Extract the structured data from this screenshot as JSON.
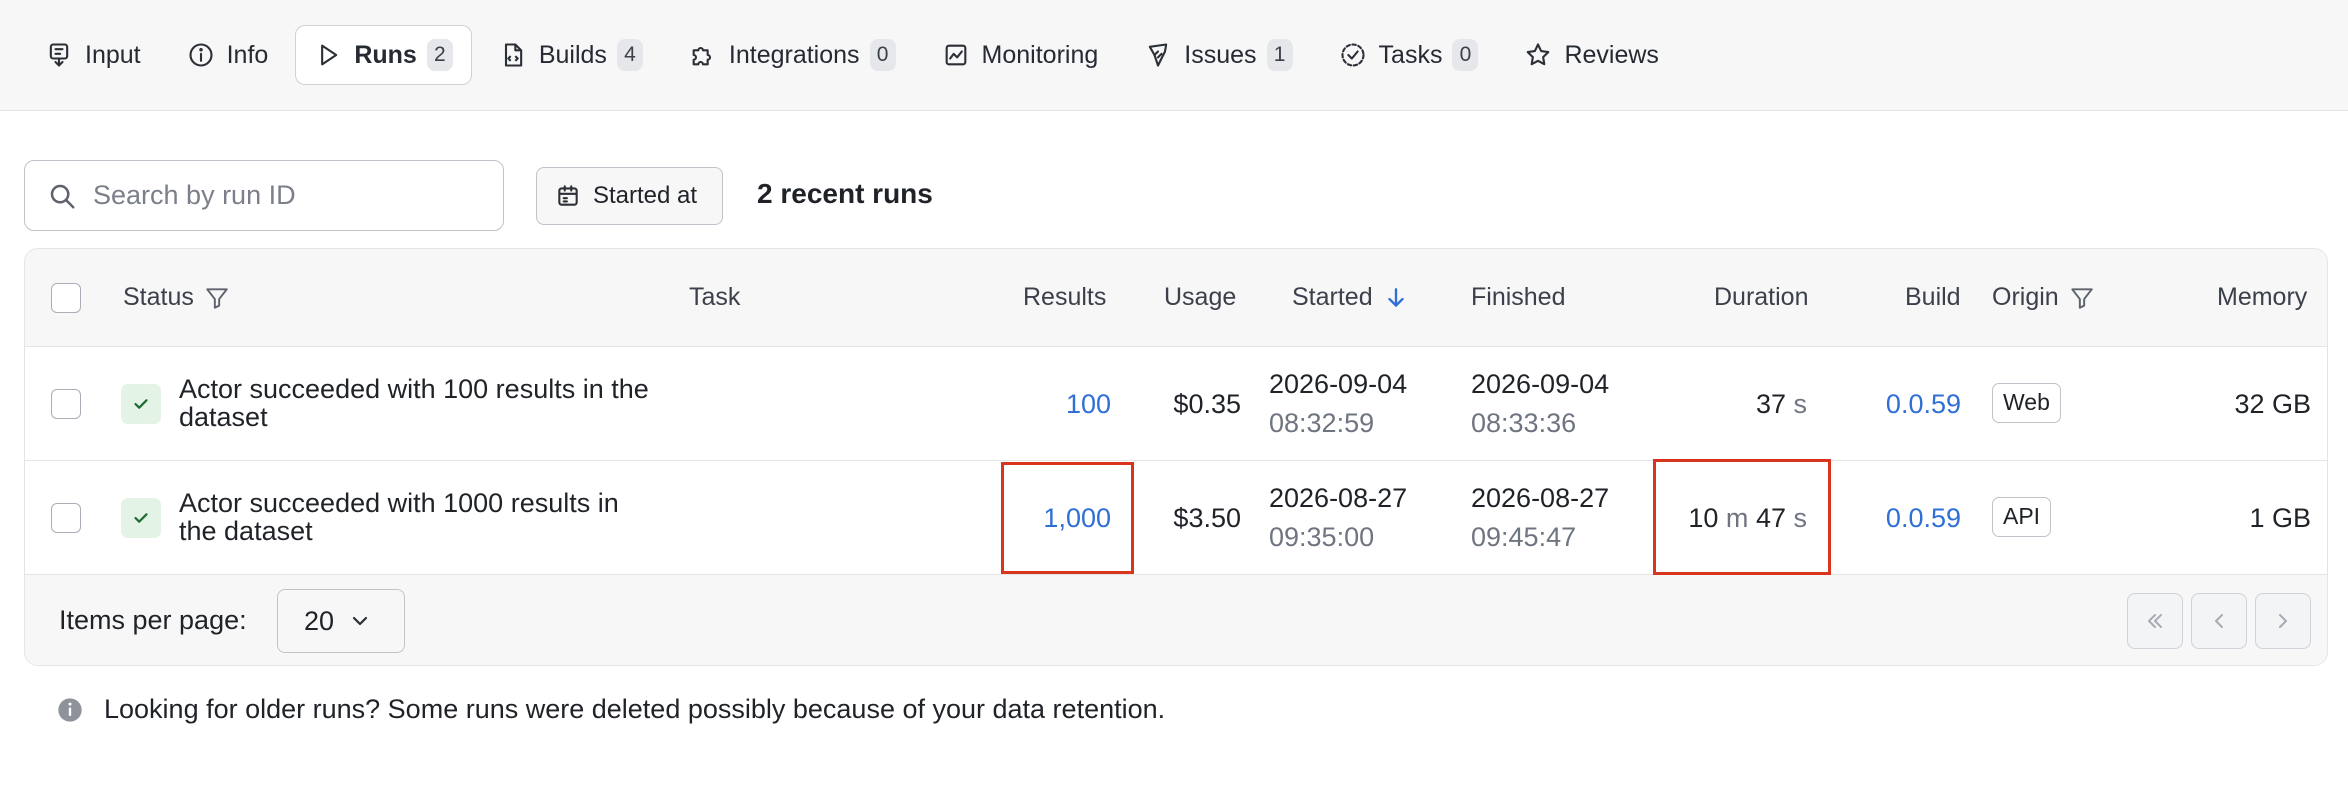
{
  "tabs": [
    {
      "label": "Input",
      "icon": "input-icon",
      "count": ""
    },
    {
      "label": "Info",
      "icon": "info-icon",
      "count": ""
    },
    {
      "label": "Runs",
      "icon": "play-icon",
      "count": "2",
      "active": true
    },
    {
      "label": "Builds",
      "icon": "file-icon",
      "count": "4"
    },
    {
      "label": "Integrations",
      "icon": "puzzle-icon",
      "count": "0"
    },
    {
      "label": "Monitoring",
      "icon": "chart-icon",
      "count": ""
    },
    {
      "label": "Issues",
      "icon": "bug-icon",
      "count": "1"
    },
    {
      "label": "Tasks",
      "icon": "task-icon",
      "count": "0"
    },
    {
      "label": "Reviews",
      "icon": "star-icon",
      "count": ""
    }
  ],
  "toolbar": {
    "search_placeholder": "Search by run ID",
    "date_filter_label": "Started at",
    "recent_runs_label": "2 recent runs"
  },
  "table": {
    "headers": {
      "status": "Status",
      "task": "Task",
      "results": "Results",
      "usage": "Usage",
      "started": "Started",
      "finished": "Finished",
      "duration": "Duration",
      "build": "Build",
      "origin": "Origin",
      "memory": "Memory"
    },
    "rows": [
      {
        "status": "Actor succeeded with 100 results in the dataset",
        "task": "",
        "results": "100",
        "usage": "$0.35",
        "started_date": "2026-09-04",
        "started_time": "08:32:59",
        "finished_date": "2026-09-04",
        "finished_time": "08:33:36",
        "duration_s": "37",
        "build": "0.0.59",
        "origin": "Web",
        "memory": "32 GB"
      },
      {
        "status": "Actor succeeded with 1000 results in the dataset",
        "task": "",
        "results": "1,000",
        "usage": "$3.50",
        "started_date": "2026-08-27",
        "started_time": "09:35:00",
        "finished_date": "2026-08-27",
        "finished_time": "09:45:47",
        "duration_m": "10",
        "duration_s": "47",
        "build": "0.0.59",
        "origin": "API",
        "memory": "1 GB"
      }
    ],
    "duration_units": {
      "m": "m",
      "s": "s"
    }
  },
  "pagination": {
    "items_per_page_label": "Items per page:",
    "items_per_page_value": "20"
  },
  "note": "Looking for older runs? Some runs were deleted possibly because of your data retention.",
  "colors": {
    "link": "#2f6fd6",
    "highlight": "#d8341e",
    "success_bg": "#e3f4e6"
  }
}
